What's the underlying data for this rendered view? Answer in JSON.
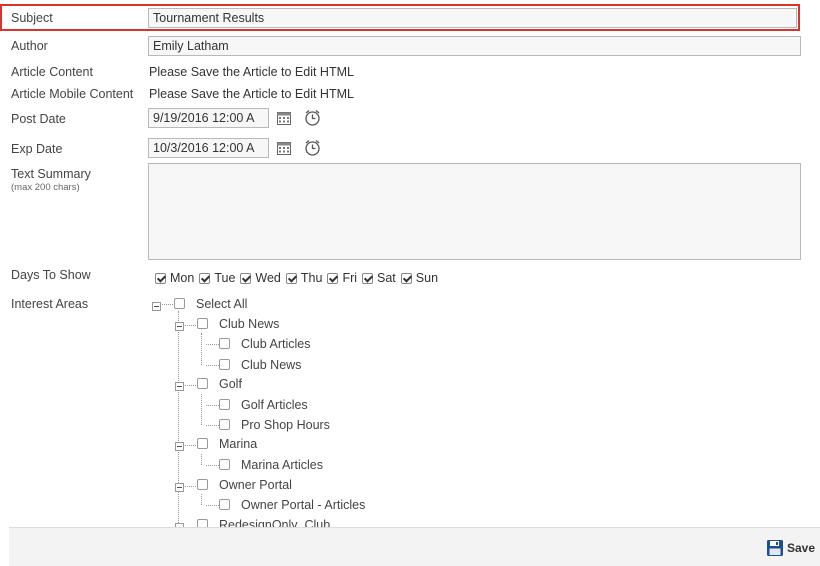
{
  "form": {
    "subject": {
      "label": "Subject",
      "value": "Tournament Results"
    },
    "author": {
      "label": "Author",
      "value": "Emily Latham"
    },
    "article_content": {
      "label": "Article Content",
      "value": "Please Save the Article to Edit HTML"
    },
    "article_mobile_content": {
      "label": "Article Mobile Content",
      "value": "Please Save the Article to Edit HTML"
    },
    "post_date": {
      "label": "Post Date",
      "value": "9/19/2016 12:00 A"
    },
    "exp_date": {
      "label": "Exp Date",
      "value": "10/3/2016 12:00 A"
    },
    "text_summary": {
      "label": "Text Summary",
      "hint": "(max 200 chars)",
      "value": ""
    },
    "days_to_show": {
      "label": "Days To Show",
      "days": [
        {
          "label": "Mon",
          "checked": true
        },
        {
          "label": "Tue",
          "checked": true
        },
        {
          "label": "Wed",
          "checked": true
        },
        {
          "label": "Thu",
          "checked": true
        },
        {
          "label": "Fri",
          "checked": true
        },
        {
          "label": "Sat",
          "checked": true
        },
        {
          "label": "Sun",
          "checked": true
        }
      ]
    },
    "interest_areas": {
      "label": "Interest Areas",
      "select_all": "Select All",
      "groups": [
        {
          "label": "Club News",
          "children": [
            "Club Articles",
            "Club News"
          ]
        },
        {
          "label": "Golf",
          "children": [
            "Golf Articles",
            "Pro Shop Hours"
          ]
        },
        {
          "label": "Marina",
          "children": [
            "Marina Articles"
          ]
        },
        {
          "label": "Owner Portal",
          "children": [
            "Owner Portal - Articles"
          ]
        },
        {
          "label": "RedesignOnly_Club",
          "children": []
        }
      ]
    }
  },
  "icons": {
    "calendar": "calendar-icon",
    "clock": "clock-icon",
    "save": "save-disk-icon"
  },
  "footer": {
    "save_label": "Save"
  },
  "colors": {
    "highlight_border": "#d9342b",
    "save_icon": "#1f4e8c"
  }
}
